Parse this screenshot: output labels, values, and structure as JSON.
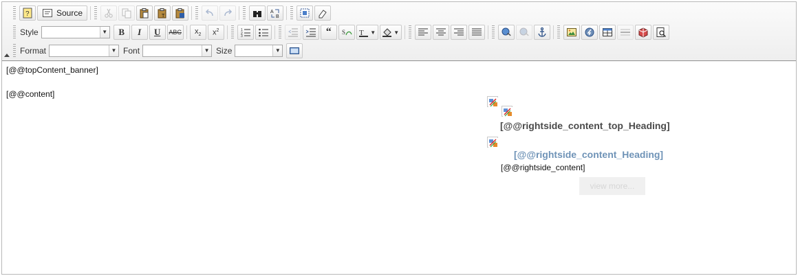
{
  "toolbar": {
    "source_label": "Source",
    "style_label": "Style",
    "format_label": "Format",
    "font_label": "Font",
    "size_label": "Size",
    "style_value": "",
    "format_value": "",
    "font_value": "",
    "size_value": ""
  },
  "content": {
    "banner_text": "[@@topContent_banner]",
    "content_text": "[@@content]",
    "rightside_top_heading": "[@@rightside_content_top_Heading]",
    "rightside_heading": "[@@rightside_content_Heading]",
    "rightside_content": "[@@rightside_content]",
    "view_more_label": "view more..."
  },
  "colors": {
    "toolbar_bg": "#f3f3f3",
    "heading_dark": "#4a4a4a",
    "heading_blue": "#6f93b7",
    "view_more_bg": "#f0f0f0",
    "view_more_text": "#d6d6d6"
  }
}
